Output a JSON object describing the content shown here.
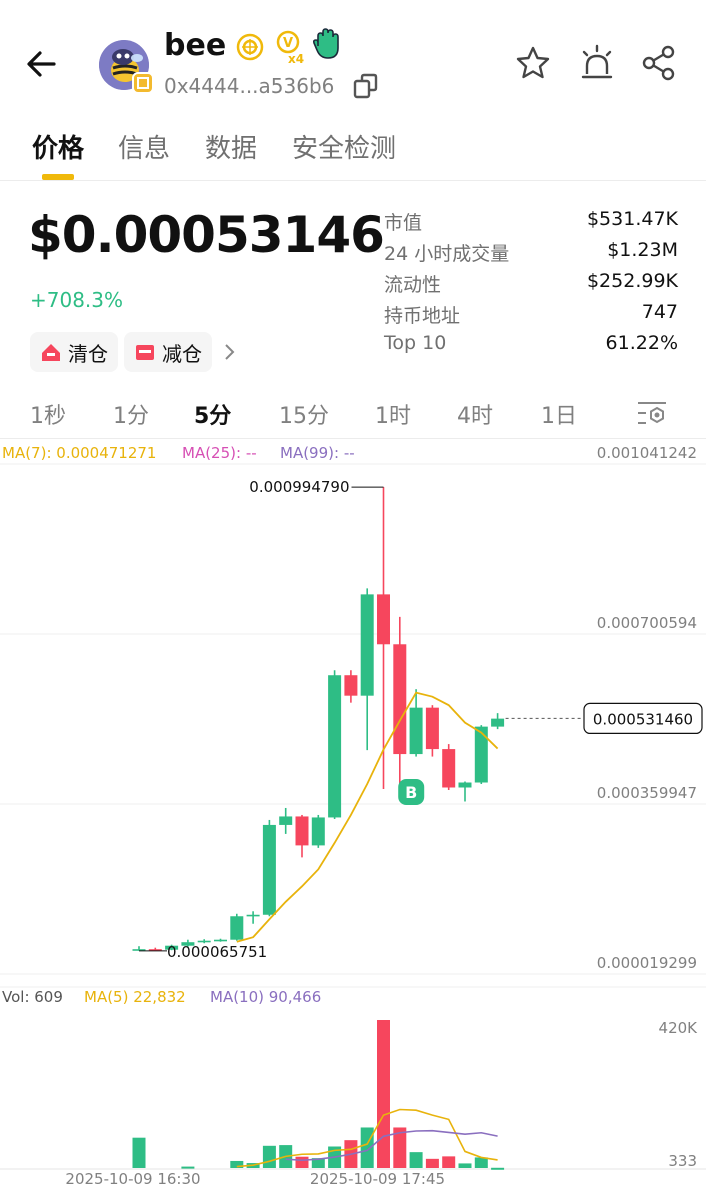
{
  "header": {
    "token_name": "bee",
    "address": "0x4444...a536b6",
    "badge_multiplier": "x4",
    "icons": [
      "back-arrow-icon",
      "star-icon",
      "alert-icon",
      "share-icon",
      "copy-icon"
    ]
  },
  "tabs": [
    {
      "label": "价格",
      "active": true
    },
    {
      "label": "信息",
      "active": false
    },
    {
      "label": "数据",
      "active": false
    },
    {
      "label": "安全检测",
      "active": false
    }
  ],
  "price": {
    "value": "$0.00053146",
    "change": "+708.3%"
  },
  "stats": [
    {
      "label": "市值",
      "value": "$531.47K"
    },
    {
      "label": "24 小时成交量",
      "value": "$1.23M"
    },
    {
      "label": "流动性",
      "value": "$252.99K"
    },
    {
      "label": "持币地址",
      "value": "747"
    },
    {
      "label": "Top 10",
      "value": "61.22%"
    }
  ],
  "actions": {
    "clear": "清仓",
    "reduce": "减仓"
  },
  "timeframes": [
    {
      "label": "1秒",
      "active": false
    },
    {
      "label": "1分",
      "active": false
    },
    {
      "label": "5分",
      "active": true
    },
    {
      "label": "15分",
      "active": false
    },
    {
      "label": "1时",
      "active": false
    },
    {
      "label": "4时",
      "active": false
    },
    {
      "label": "1日",
      "active": false
    }
  ],
  "colors": {
    "up": "#2ebd85",
    "down": "#f6465d",
    "ma7": "#e8b30c",
    "ma25": "#d64fb4",
    "ma99": "#8a6fbf",
    "accent": "#f0b90b"
  },
  "chart_data": {
    "type": "candlestick",
    "ma_legend": {
      "ma7": "MA(7): 0.000471271",
      "ma25": "MA(25): --",
      "ma99": "MA(99): --"
    },
    "y_axis_labels": [
      "0.001041242",
      "0.000700594",
      "0.000359947",
      "0.000019299"
    ],
    "y_ticks": [
      0.001041242,
      0.000700594,
      0.000359947,
      1.9299e-05
    ],
    "ylim": [
      1.9299e-05,
      0.001041242
    ],
    "current_price_label": "0.000531460",
    "current_price": 0.00053146,
    "high_marker": {
      "label": "0.000994790",
      "value": 0.00099479
    },
    "low_marker": {
      "label": "0.000065751",
      "value": 6.5751e-05
    },
    "buy_marker": "B",
    "candles": [
      {
        "o": 6.6e-05,
        "h": 7.5e-05,
        "l": 6.6e-05,
        "c": 6.9e-05
      },
      {
        "o": 6.9e-05,
        "h": 7.2e-05,
        "l": 6.6e-05,
        "c": 6.8e-05
      },
      {
        "o": 6.8e-05,
        "h": 7.8e-05,
        "l": 6.7e-05,
        "c": 7.6e-05
      },
      {
        "o": 7.6e-05,
        "h": 8.8e-05,
        "l": 7.4e-05,
        "c": 8.3e-05
      },
      {
        "o": 8.3e-05,
        "h": 8.9e-05,
        "l": 8.1e-05,
        "c": 8.6e-05
      },
      {
        "o": 8.6e-05,
        "h": 9e-05,
        "l": 8.4e-05,
        "c": 8.8e-05
      },
      {
        "o": 8.8e-05,
        "h": 0.00014,
        "l": 8.6e-05,
        "c": 0.000135
      },
      {
        "o": 0.000135,
        "h": 0.000145,
        "l": 0.00012,
        "c": 0.000138
      },
      {
        "o": 0.000138,
        "h": 0.000328,
        "l": 0.000135,
        "c": 0.000318
      },
      {
        "o": 0.000318,
        "h": 0.000352,
        "l": 0.0003,
        "c": 0.000335
      },
      {
        "o": 0.000335,
        "h": 0.000338,
        "l": 0.000253,
        "c": 0.000277
      },
      {
        "o": 0.000277,
        "h": 0.000338,
        "l": 0.000272,
        "c": 0.000333
      },
      {
        "o": 0.000333,
        "h": 0.000628,
        "l": 0.00033,
        "c": 0.000618
      },
      {
        "o": 0.000618,
        "h": 0.000628,
        "l": 0.000563,
        "c": 0.000577
      },
      {
        "o": 0.000577,
        "h": 0.000792,
        "l": 0.000468,
        "c": 0.00078
      },
      {
        "o": 0.00078,
        "h": 0.000995,
        "l": 0.00039,
        "c": 0.00068
      },
      {
        "o": 0.00068,
        "h": 0.000735,
        "l": 0.000393,
        "c": 0.00046
      },
      {
        "o": 0.00046,
        "h": 0.00059,
        "l": 0.000455,
        "c": 0.000553
      },
      {
        "o": 0.000553,
        "h": 0.000558,
        "l": 0.000455,
        "c": 0.00047
      },
      {
        "o": 0.00047,
        "h": 0.00048,
        "l": 0.000388,
        "c": 0.000393
      },
      {
        "o": 0.000393,
        "h": 0.000405,
        "l": 0.000365,
        "c": 0.000403
      },
      {
        "o": 0.000403,
        "h": 0.000518,
        "l": 0.0004,
        "c": 0.000515
      },
      {
        "o": 0.000515,
        "h": 0.000542,
        "l": 0.00051,
        "c": 0.000531
      }
    ],
    "ma7": [
      null,
      null,
      null,
      null,
      null,
      null,
      8.4e-05,
      9.3e-05,
      0.000129,
      0.000164,
      0.000195,
      0.000229,
      0.000282,
      0.000338,
      0.0004,
      0.000469,
      0.000527,
      0.000583,
      0.000575,
      0.000558,
      0.000523,
      0.000503,
      0.000471
    ],
    "volume": {
      "legend": {
        "vol": "Vol: 609",
        "ma5": "MA(5) 22,832",
        "ma10": "MA(10) 90,466"
      },
      "axis_labels": [
        "420K",
        "333"
      ],
      "ylim": [
        0,
        420000
      ],
      "bars": [
        {
          "v": 86000,
          "up": true
        },
        {
          "v": 0,
          "up": true
        },
        {
          "v": 0,
          "up": true
        },
        {
          "v": 4000,
          "up": true
        },
        {
          "v": 0,
          "up": true
        },
        {
          "v": 0,
          "up": true
        },
        {
          "v": 20000,
          "up": true
        },
        {
          "v": 14000,
          "up": true
        },
        {
          "v": 63000,
          "up": true
        },
        {
          "v": 65000,
          "up": true
        },
        {
          "v": 32000,
          "up": false
        },
        {
          "v": 28000,
          "up": true
        },
        {
          "v": 61000,
          "up": true
        },
        {
          "v": 79000,
          "up": false
        },
        {
          "v": 115000,
          "up": true
        },
        {
          "v": 420000,
          "up": false
        },
        {
          "v": 115000,
          "up": false
        },
        {
          "v": 45000,
          "up": true
        },
        {
          "v": 26000,
          "up": false
        },
        {
          "v": 33000,
          "up": false
        },
        {
          "v": 13000,
          "up": true
        },
        {
          "v": 30000,
          "up": true
        },
        {
          "v": 609,
          "up": true
        }
      ],
      "ma5": [
        null,
        null,
        null,
        null,
        null,
        null,
        4000,
        8000,
        19000,
        33000,
        39000,
        40000,
        50000,
        53000,
        68000,
        150000,
        166000,
        164000,
        150000,
        138000,
        47000,
        30000,
        22832
      ],
      "ma10": [
        null,
        null,
        null,
        null,
        null,
        null,
        null,
        null,
        null,
        25000,
        22000,
        25000,
        31000,
        39000,
        50000,
        90000,
        100000,
        105000,
        106000,
        101000,
        96000,
        100000,
        90466
      ]
    },
    "x_labels": [
      {
        "label": "2025-10-09 16:30",
        "index": 0
      },
      {
        "label": "2025-10-09 17:45",
        "index": 15
      }
    ]
  }
}
